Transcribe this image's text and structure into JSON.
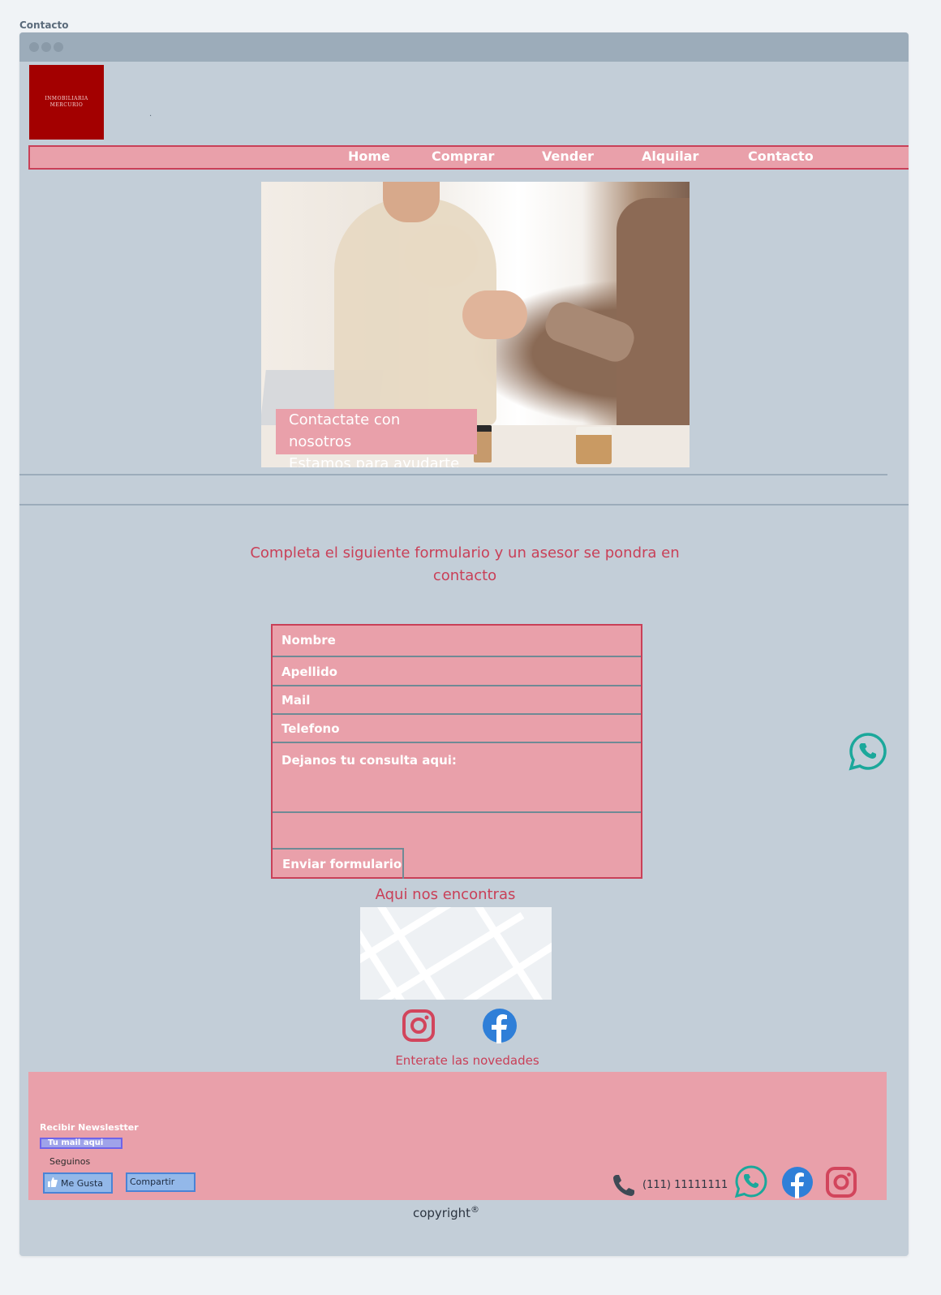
{
  "page": {
    "label": "Contacto"
  },
  "logo": {
    "line1": "INMOBILIARIA",
    "line2": "MERCURIO"
  },
  "nav": {
    "items": [
      "Home",
      "Comprar",
      "Vender",
      "Alquilar",
      "Contacto"
    ]
  },
  "hero": {
    "caption_line1": "Contactate con nosotros",
    "caption_line2": "Estamos para ayudarte"
  },
  "form": {
    "intro": "Completa el siguiente formulario y un asesor se pondra en contacto",
    "fields": {
      "nombre": "Nombre",
      "apellido": "Apellido",
      "mail": "Mail",
      "telefono": "Telefono",
      "consulta": "Dejanos tu consulta aqui:"
    },
    "submit": "Enviar formulario"
  },
  "map": {
    "title": "Aqui nos encontras"
  },
  "newsletter": {
    "title": "Enterate las novedades",
    "label": "Recibir Newslestter",
    "input_placeholder": "Tu mail aqui"
  },
  "footer": {
    "seguinos": "Seguinos",
    "like_label": "Me Gusta",
    "share_label": "Compartir",
    "phone": "(111) 11111111",
    "copyright": "copyright",
    "copyright_mark": "®"
  },
  "colors": {
    "accent": "#c94058",
    "pink": "#e9a0aa",
    "background": "#c3ced8",
    "whatsapp": "#1ba89b",
    "facebook": "#2f7fd8",
    "instagram": "#d2455c"
  }
}
